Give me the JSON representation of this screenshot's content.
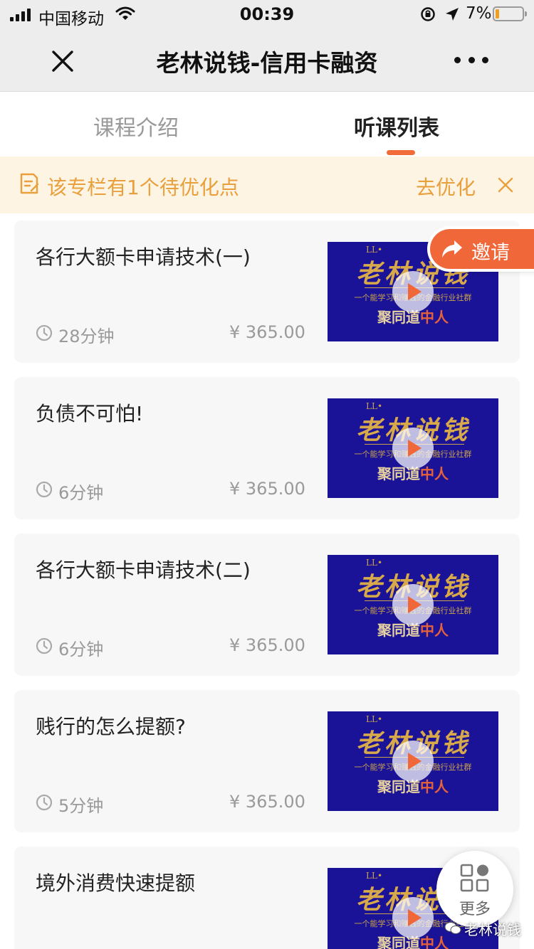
{
  "status_bar": {
    "carrier": "中国移动",
    "time": "00:39",
    "battery_percent": "7%",
    "battery_level": 0.07
  },
  "nav": {
    "title": "老林说钱-信用卡融资",
    "close_icon": "close-icon",
    "more_icon": "more-dots-icon"
  },
  "tabs": [
    {
      "label": "课程介绍",
      "active": false
    },
    {
      "label": "听课列表",
      "active": true
    }
  ],
  "notice": {
    "text": "该专栏有1个待优化点",
    "action": "去优化"
  },
  "invite": {
    "label": "邀请"
  },
  "courses": [
    {
      "title": "各行大额卡申请技术(一)",
      "duration": "28分钟",
      "price": "¥  365.00"
    },
    {
      "title": "负债不可怕!",
      "duration": "6分钟",
      "price": "¥  365.00"
    },
    {
      "title": "各行大额卡申请技术(二)",
      "duration": "6分钟",
      "price": "¥  365.00"
    },
    {
      "title": "贱行的怎么提额?",
      "duration": "5分钟",
      "price": "¥  365.00"
    },
    {
      "title": "境外消费快速提额",
      "duration": "",
      "price": ""
    }
  ],
  "thumbnail": {
    "ll": "LL•",
    "brand": "老林说钱",
    "tagline": "一个能学习和赚钱的金融行业社群",
    "slogan_a": "聚同道",
    "slogan_b": "中人"
  },
  "more_button": {
    "label": "更多"
  },
  "watermark": {
    "text": "老林说钱"
  },
  "colors": {
    "accent": "#f0683a",
    "notice_text": "#e9a03c",
    "notice_bg": "#fdf4e4",
    "thumb_bg": "#1a1397"
  }
}
